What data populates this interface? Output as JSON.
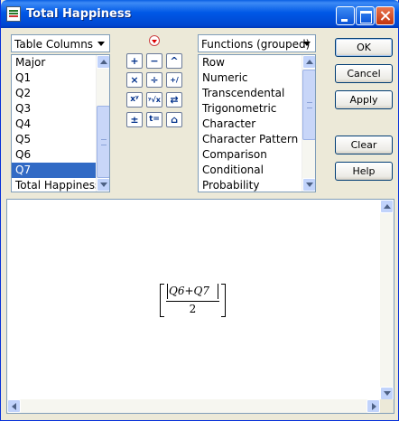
{
  "window": {
    "title": "Total Happiness"
  },
  "columns": {
    "dropdown_label": "Table Columns",
    "items": [
      "Major",
      "Q1",
      "Q2",
      "Q3",
      "Q4",
      "Q5",
      "Q6",
      "Q7",
      "Total Happiness"
    ],
    "selected": "Q7"
  },
  "functions": {
    "dropdown_label": "Functions (grouped)",
    "items": [
      "Row",
      "Numeric",
      "Transcendental",
      "Trigonometric",
      "Character",
      "Character Pattern",
      "Comparison",
      "Conditional",
      "Probability"
    ]
  },
  "operators": [
    {
      "name": "add-icon",
      "glyph": "+"
    },
    {
      "name": "subtract-icon",
      "glyph": "−"
    },
    {
      "name": "caret-up-icon",
      "glyph": "^"
    },
    {
      "name": "multiply-icon",
      "glyph": "×"
    },
    {
      "name": "divide-icon",
      "glyph": "÷"
    },
    {
      "name": "negate-icon",
      "glyph": "+/−"
    },
    {
      "name": "power-icon",
      "glyph": "xʸ"
    },
    {
      "name": "root-icon",
      "glyph": "ʸ√x"
    },
    {
      "name": "swap-icon",
      "glyph": "⇄"
    },
    {
      "name": "plus-minus-icon",
      "glyph": "±"
    },
    {
      "name": "assign-icon",
      "glyph": "t="
    },
    {
      "name": "peel-icon",
      "glyph": "⌂"
    }
  ],
  "buttons": {
    "ok": "OK",
    "cancel": "Cancel",
    "apply": "Apply",
    "clear": "Clear",
    "help": "Help"
  },
  "formula": {
    "numerator": "Q6+Q7",
    "denominator": "2"
  }
}
